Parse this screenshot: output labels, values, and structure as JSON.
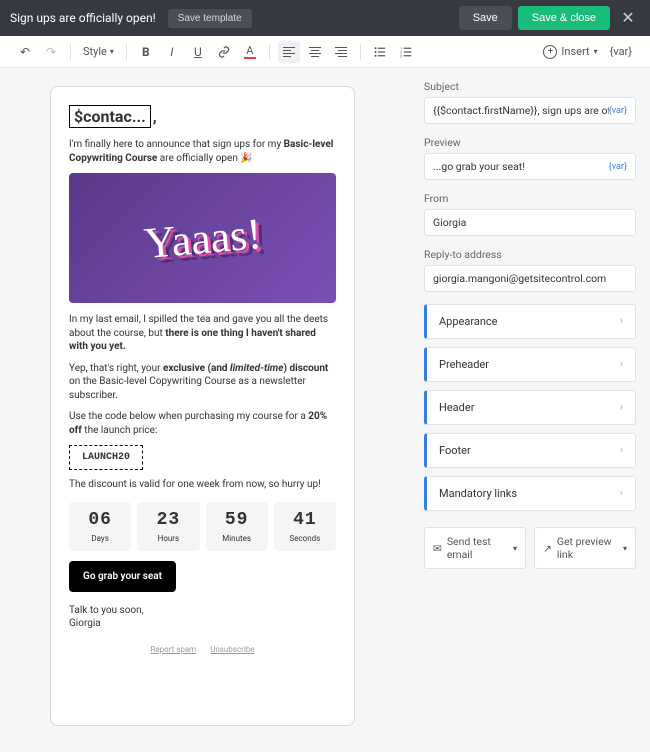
{
  "topbar": {
    "title": "Sign ups are officially open!",
    "save_template": "Save template",
    "save": "Save",
    "save_close": "Save & close"
  },
  "toolbar": {
    "style": "Style",
    "insert": "Insert",
    "var": "{var}"
  },
  "email": {
    "preheader_token": "$contac...",
    "p1_a": "I'm finally here to announce that sign ups for my ",
    "p1_b": "Basic-level Copywriting Course",
    "p1_c": " are officially open 🎉",
    "hero_text": "Yaaas!",
    "p2_a": "In my last email, I spilled the tea and gave you all the deets about the course, but ",
    "p2_b": "there is one thing I haven't shared with you yet.",
    "p3_a": "Yep, that's right, your ",
    "p3_b": "exclusive (and ",
    "p3_c": "limited-time",
    "p3_d": ") discount",
    "p3_e": " on the Basic-level Copywriting Course as a newsletter subscriber.",
    "p4_a": "Use the code below when purchasing my course for a ",
    "p4_b": "20% off",
    "p4_c": " the launch price:",
    "coupon": "LAUNCH20",
    "p5": "The discount is valid for one week from now, so hurry up!",
    "countdown": {
      "days": {
        "num": "06",
        "label": "Days"
      },
      "hours": {
        "num": "23",
        "label": "Hours"
      },
      "minutes": {
        "num": "59",
        "label": "Minutes"
      },
      "seconds": {
        "num": "41",
        "label": "Seconds"
      }
    },
    "cta": "Go grab your seat",
    "signoff_a": "Talk to you soon,",
    "signoff_b": "Giorgia",
    "footer_spam": "Report spam",
    "footer_unsub": "Unsubscribe"
  },
  "side": {
    "subject_label": "Subject",
    "subject_value": "{{$contact.firstName}}, sign ups are officially open",
    "preview_label": "Preview",
    "preview_value": "...go grab your seat!",
    "from_label": "From",
    "from_value": "Giorgia",
    "replyto_label": "Reply-to address",
    "replyto_value": "giorgia.mangoni@getsitecontrol.com",
    "var_btn": "{var}",
    "sections": {
      "appearance": "Appearance",
      "preheader": "Preheader",
      "header": "Header",
      "footer": "Footer",
      "mandatory": "Mandatory links"
    },
    "send_test": "Send test email",
    "get_preview": "Get preview link"
  }
}
